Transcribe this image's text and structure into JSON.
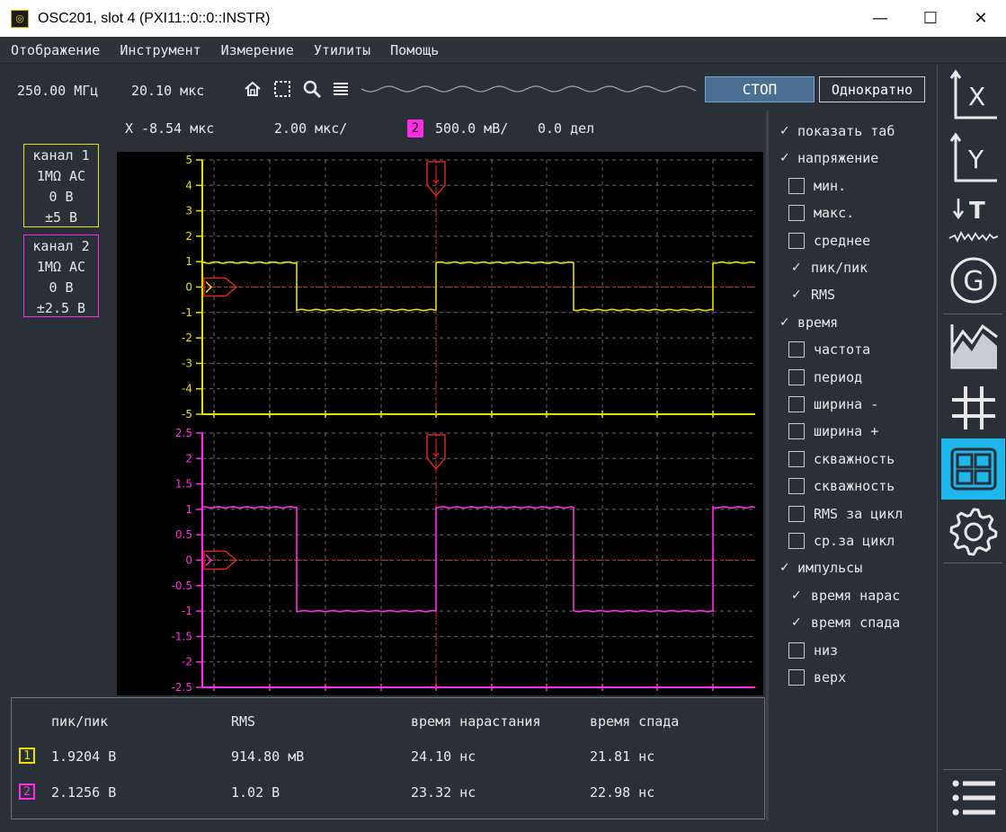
{
  "window": {
    "title": "OSC201, slot 4 (PXI11::0::0::INSTR)",
    "minimize": "—",
    "maximize": "☐",
    "close": "✕"
  },
  "menu": [
    "Отображение",
    "Инструмент",
    "Измерение",
    "Утилиты",
    "Помощь"
  ],
  "toolbar": {
    "sample_rate": "250.00 МГц",
    "record_length": "20.10 мкс",
    "stop_label": "СТОП",
    "single_label": "Однократно"
  },
  "infoline": {
    "x_pos": "X -8.54 мкс",
    "timebase": "2.00 мкс/",
    "channel_badge": "2",
    "vscale": "500.0 мВ/",
    "offset": "0.0 дел"
  },
  "channels": [
    {
      "name": "канал 1",
      "coupling": "1MΩ AC",
      "offset": "0 В",
      "range": "±5 В",
      "color": "#e7e100"
    },
    {
      "name": "канал 2",
      "coupling": "1MΩ AC",
      "offset": "0 В",
      "range": "±2.5 В",
      "color": "#ff2ee6"
    }
  ],
  "plots": [
    {
      "color": "#e7e100",
      "ticks": [
        "5",
        "4",
        "3",
        "2",
        "1",
        "0",
        "-1",
        "-2",
        "-3",
        "-4",
        "-5"
      ],
      "ymax": 5,
      "ymin": -5,
      "high": 0.96,
      "low": -0.9
    },
    {
      "color": "#ff2ee6",
      "ticks": [
        "2.5",
        "2",
        "1.5",
        "1",
        "0.5",
        "0",
        "-0.5",
        "-1",
        "-1.5",
        "-2",
        "-2.5"
      ],
      "ymax": 2.5,
      "ymin": -2.5,
      "high": 1.04,
      "low": -1.0
    }
  ],
  "results": {
    "headers": [
      "пик/пик",
      "RMS",
      "время нарастания",
      "время спада"
    ],
    "rows": [
      {
        "badge": "1",
        "values": [
          "1.9204 В",
          "914.80 мВ",
          "24.10 нс",
          "21.81 нс"
        ]
      },
      {
        "badge": "2",
        "values": [
          "2.1256 В",
          "1.02 В",
          "23.32 нс",
          "22.98 нс"
        ]
      }
    ]
  },
  "measurements": [
    {
      "label": "показать таб",
      "type": "group",
      "checked": true
    },
    {
      "label": "напряжение",
      "type": "group",
      "checked": true
    },
    {
      "label": "мин.",
      "type": "item",
      "checked": false
    },
    {
      "label": "макс.",
      "type": "item",
      "checked": false
    },
    {
      "label": "среднее",
      "type": "item",
      "checked": false
    },
    {
      "label": "пик/пик",
      "type": "item",
      "checked": true
    },
    {
      "label": "RMS",
      "type": "item",
      "checked": true
    },
    {
      "label": "время",
      "type": "group",
      "checked": true
    },
    {
      "label": "частота",
      "type": "item",
      "checked": false
    },
    {
      "label": "период",
      "type": "item",
      "checked": false
    },
    {
      "label": "ширина -",
      "type": "item",
      "checked": false
    },
    {
      "label": "ширина +",
      "type": "item",
      "checked": false
    },
    {
      "label": "скважность",
      "type": "item",
      "checked": false
    },
    {
      "label": "скважность",
      "type": "item",
      "checked": false
    },
    {
      "label": "RMS за цикл",
      "type": "item",
      "checked": false
    },
    {
      "label": "ср.за цикл",
      "type": "item",
      "checked": false
    },
    {
      "label": "импульсы",
      "type": "group",
      "checked": true
    },
    {
      "label": "время нарас",
      "type": "item",
      "checked": true
    },
    {
      "label": "время спада",
      "type": "item",
      "checked": true
    },
    {
      "label": "низ",
      "type": "item",
      "checked": false
    },
    {
      "label": "верх",
      "type": "item",
      "checked": false
    }
  ],
  "side_icons": {
    "x_axis": "X",
    "y_axis": "Y",
    "trigger": "T",
    "generator": "G"
  }
}
